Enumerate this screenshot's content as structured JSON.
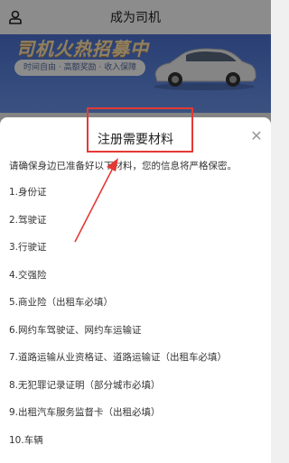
{
  "header": {
    "title": "成为司机",
    "back_icon": "profile-icon"
  },
  "banner": {
    "headline": "司机火热招募中",
    "pill": "时间自由 · 高额奖励 · 收入保障"
  },
  "sheet": {
    "title": "注册需要材料",
    "intro": "请确保身边已准备好以下材料，您的信息将严格保密。",
    "items": [
      "1.身份证",
      "2.驾驶证",
      "3.行驶证",
      "4.交强险",
      "5.商业险（出租车必填）",
      "6.网约车驾驶证、网约车运输证",
      "7.道路运输从业资格证、道路运输证（出租车必填）",
      "8.无犯罪记录证明（部分城市必填）",
      "9.出租汽车服务监督卡（出租必填）",
      "10.车辆"
    ]
  },
  "colors": {
    "highlight": "#e53935",
    "banner": "#5d86e2"
  }
}
